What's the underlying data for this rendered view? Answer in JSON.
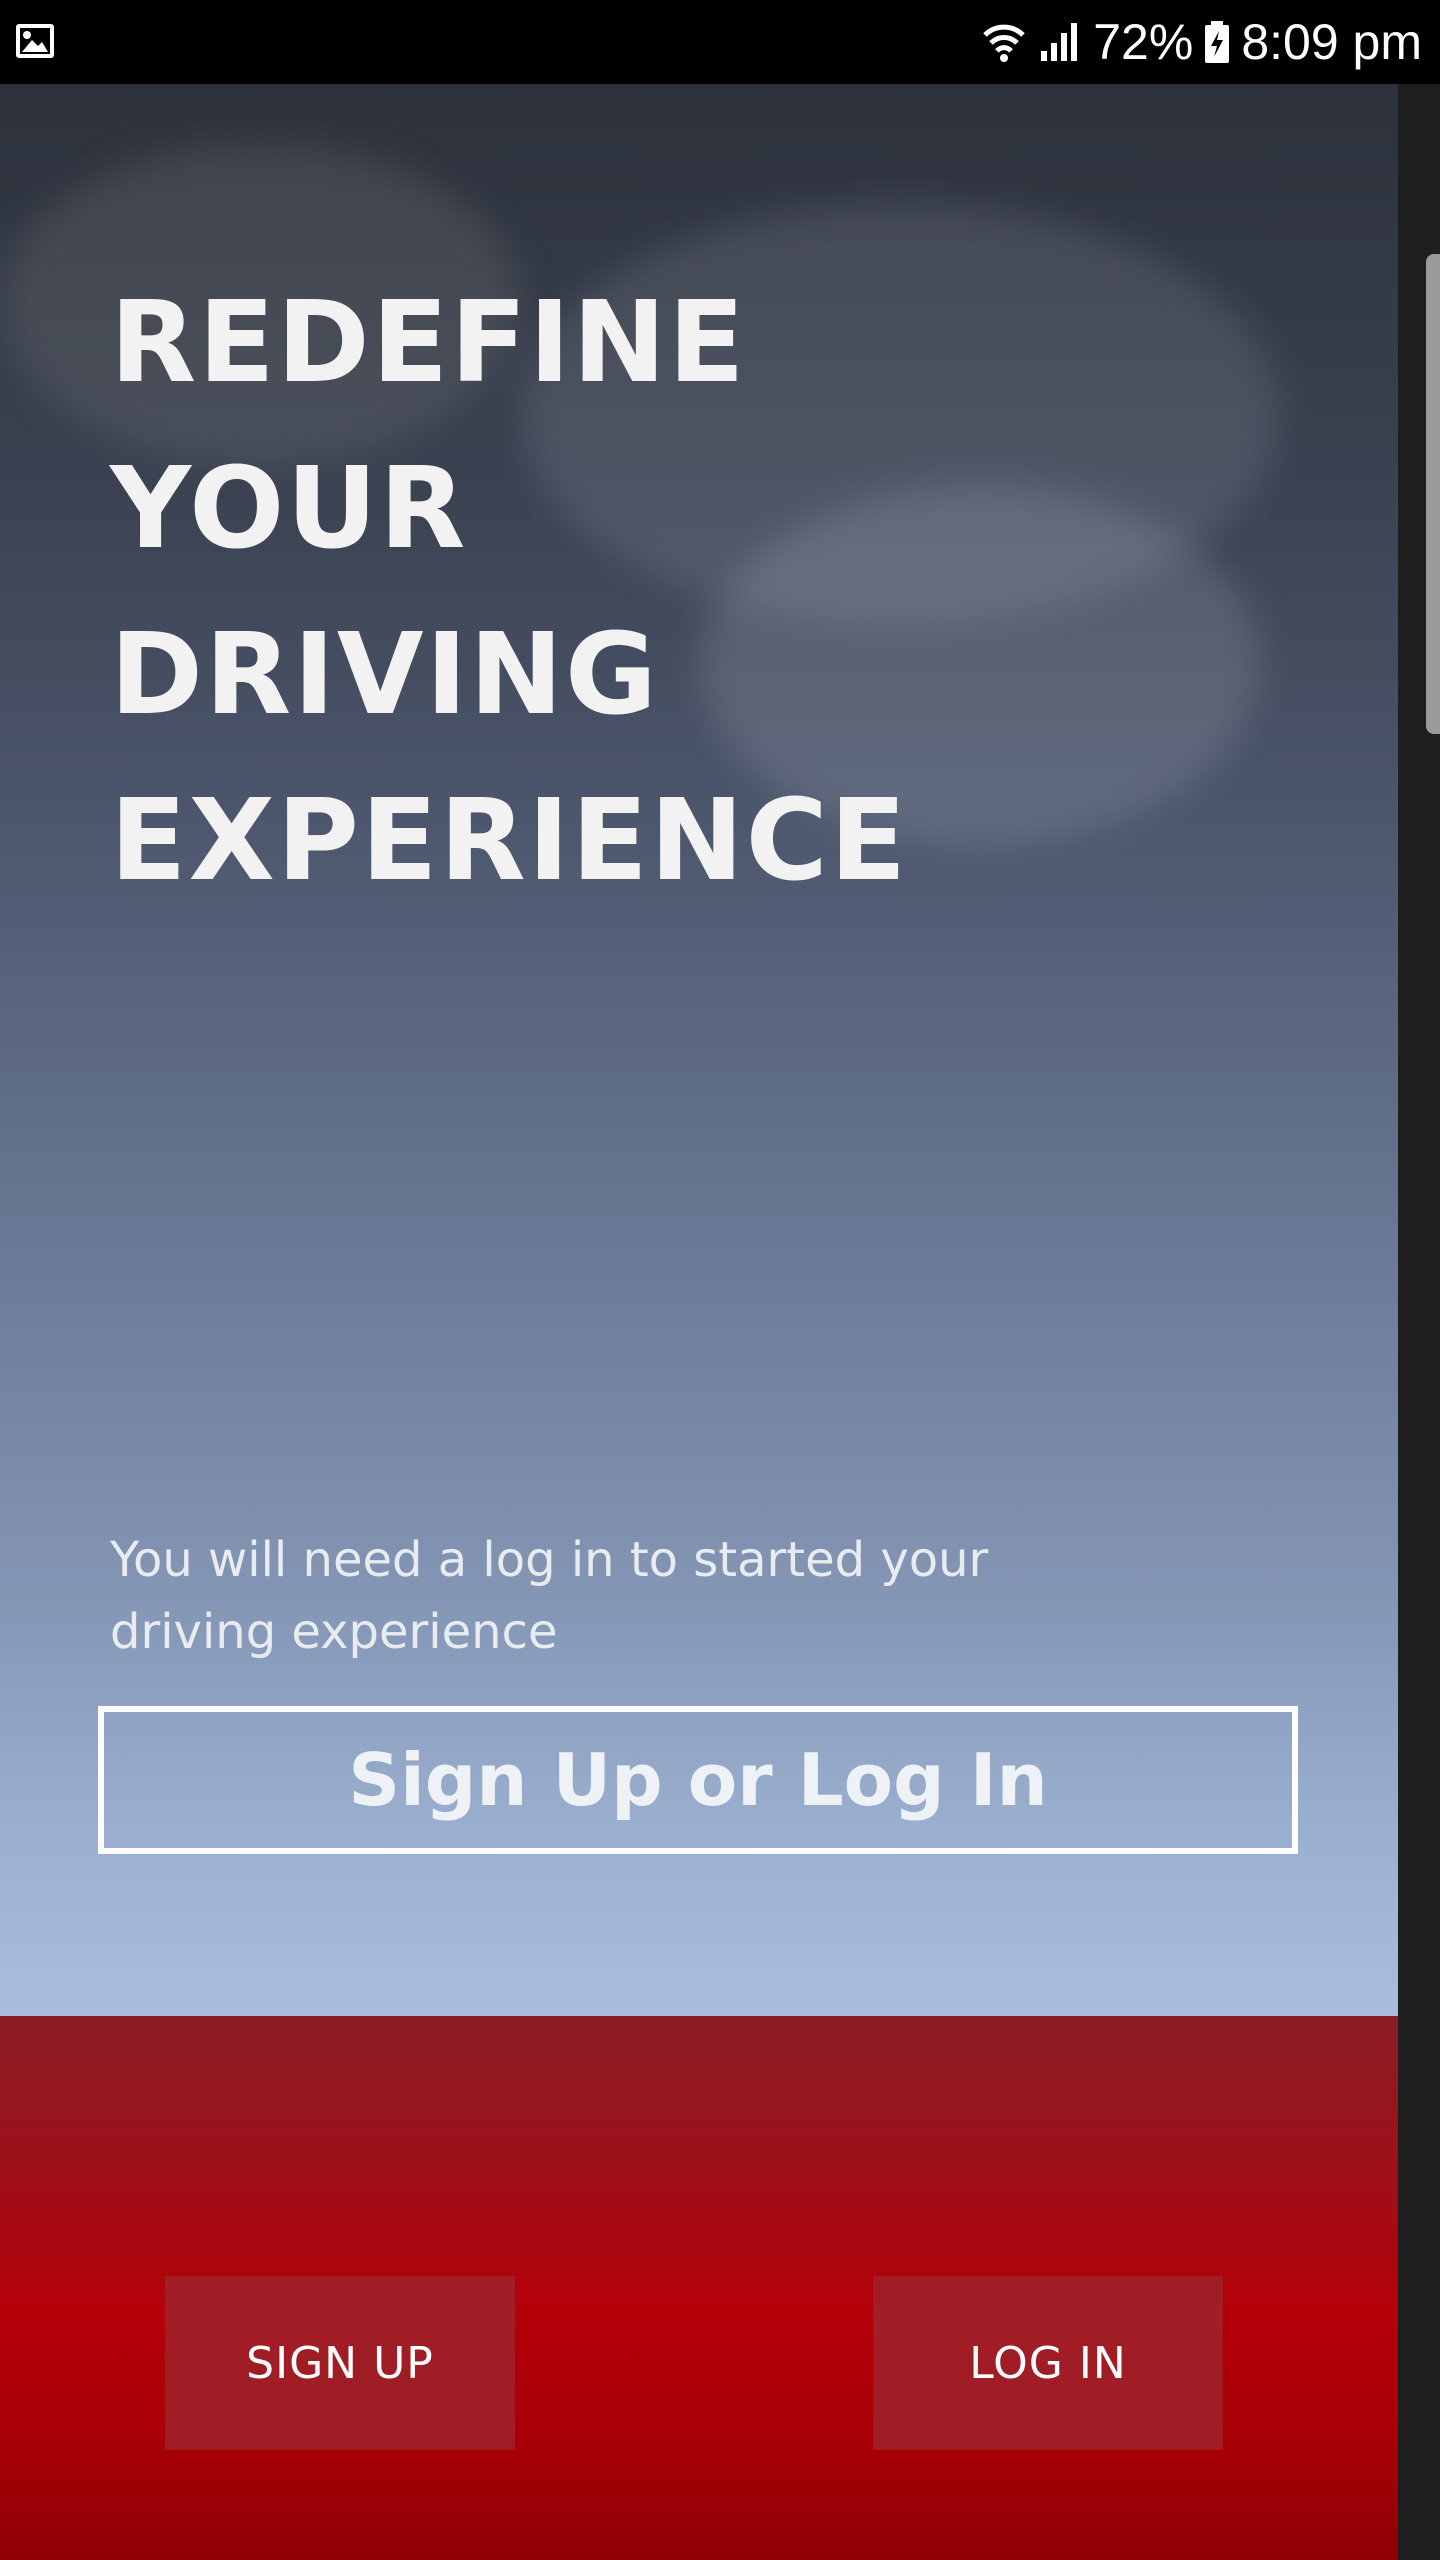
{
  "status_bar": {
    "battery_percent": "72%",
    "time": "8:09 pm",
    "icons": [
      "gallery-notification-icon",
      "wifi-icon",
      "cellular-signal-icon",
      "battery-charging-icon"
    ]
  },
  "hero": {
    "headline_lines": [
      "REDEFINE",
      "YOUR",
      "DRIVING",
      "EXPERIENCE"
    ],
    "subtext": "You will need a log in to started your driving experience",
    "cta_label": "Sign Up or Log In"
  },
  "footer": {
    "signup_label": "SIGN UP",
    "login_label": "LOG IN"
  },
  "colors": {
    "footer_red": "#b50008",
    "footer_button": "#a01d25",
    "headline_text": "#f2f2f2"
  }
}
